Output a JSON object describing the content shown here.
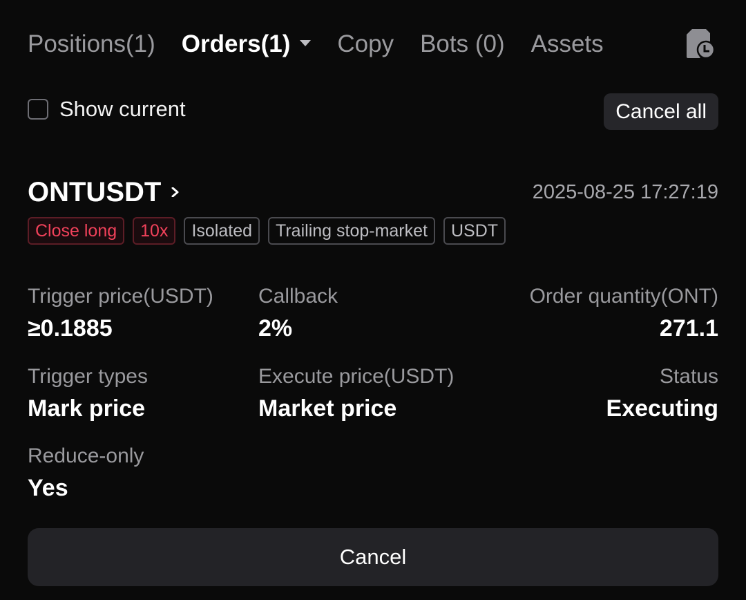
{
  "tabs": [
    {
      "label": "Positions(1)"
    },
    {
      "label": "Orders(1)"
    },
    {
      "label": "Copy"
    },
    {
      "label": "Bots (0)"
    },
    {
      "label": "Assets"
    }
  ],
  "filter": {
    "show_current_label": "Show current",
    "show_current_checked": false
  },
  "toolbar": {
    "cancel_all_label": "Cancel all"
  },
  "order": {
    "symbol": "ONTUSDT",
    "timestamp": "2025-08-25 17:27:19",
    "tags": {
      "side": "Close long",
      "leverage": "10x",
      "margin_mode": "Isolated",
      "order_type": "Trailing stop-market",
      "settle": "USDT"
    },
    "fields": {
      "trigger_price": {
        "label": "Trigger price(USDT)",
        "value": "≥0.1885"
      },
      "callback": {
        "label": "Callback",
        "value": "2%"
      },
      "order_quantity": {
        "label": "Order quantity(ONT)",
        "value": "271.1"
      },
      "trigger_types": {
        "label": "Trigger types",
        "value": "Mark price"
      },
      "execute_price": {
        "label": "Execute price(USDT)",
        "value": "Market price"
      },
      "status": {
        "label": "Status",
        "value": "Executing"
      },
      "reduce_only": {
        "label": "Reduce-only",
        "value": "Yes"
      }
    },
    "cancel_label": "Cancel"
  },
  "icons": {
    "history": "order-history-icon",
    "caret": "caret-down-icon",
    "chevron": "chevron-right-icon"
  },
  "colors": {
    "background": "#0a0a0a",
    "accent_red": "#f0415a",
    "muted_text": "#9a9a9e",
    "button_bg": "#232327"
  }
}
